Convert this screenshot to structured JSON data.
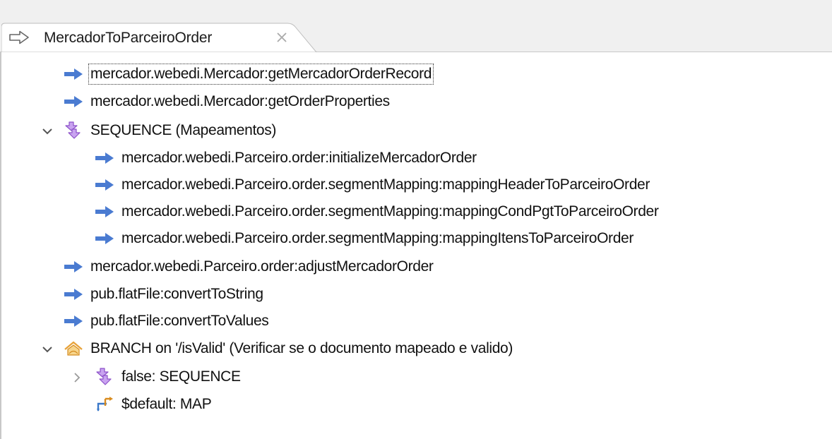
{
  "editor_tab": {
    "title": "MercadorToParceiroOrder",
    "icon": "flow-arrow-outline-icon",
    "close_icon": "close-x-icon"
  },
  "colors": {
    "invoke_arrow": "#4a7bd1",
    "sequence": "#a569d8",
    "branch": "#e8a33a",
    "map": "#3a78c9"
  },
  "tree": {
    "rows": [
      {
        "label": "mercador.webedi.Mercador:getMercadorOrderRecord",
        "icon": "invoke-arrow-icon",
        "selected": true
      },
      {
        "label": "mercador.webedi.Mercador:getOrderProperties",
        "icon": "invoke-arrow-icon"
      },
      {
        "label": "SEQUENCE (Mapeamentos)",
        "icon": "sequence-icon",
        "expanded": true
      },
      {
        "label": "mercador.webedi.Parceiro.order:initializeMercadorOrder",
        "icon": "invoke-arrow-icon"
      },
      {
        "label": "mercador.webedi.Parceiro.order.segmentMapping:mappingHeaderToParceiroOrder",
        "icon": "invoke-arrow-icon"
      },
      {
        "label": "mercador.webedi.Parceiro.order.segmentMapping:mappingCondPgtToParceiroOrder",
        "icon": "invoke-arrow-icon"
      },
      {
        "label": "mercador.webedi.Parceiro.order.segmentMapping:mappingItensToParceiroOrder",
        "icon": "invoke-arrow-icon"
      },
      {
        "label": "mercador.webedi.Parceiro.order:adjustMercadorOrder",
        "icon": "invoke-arrow-icon"
      },
      {
        "label": "pub.flatFile:convertToString",
        "icon": "invoke-arrow-icon"
      },
      {
        "label": "pub.flatFile:convertToValues",
        "icon": "invoke-arrow-icon"
      },
      {
        "label": "BRANCH on '/isValid' (Verificar se o documento mapeado e valido)",
        "icon": "branch-icon",
        "expanded": true
      },
      {
        "label": "false: SEQUENCE",
        "icon": "sequence-icon",
        "expanded": false
      },
      {
        "label": "$default: MAP",
        "icon": "map-icon"
      }
    ]
  }
}
